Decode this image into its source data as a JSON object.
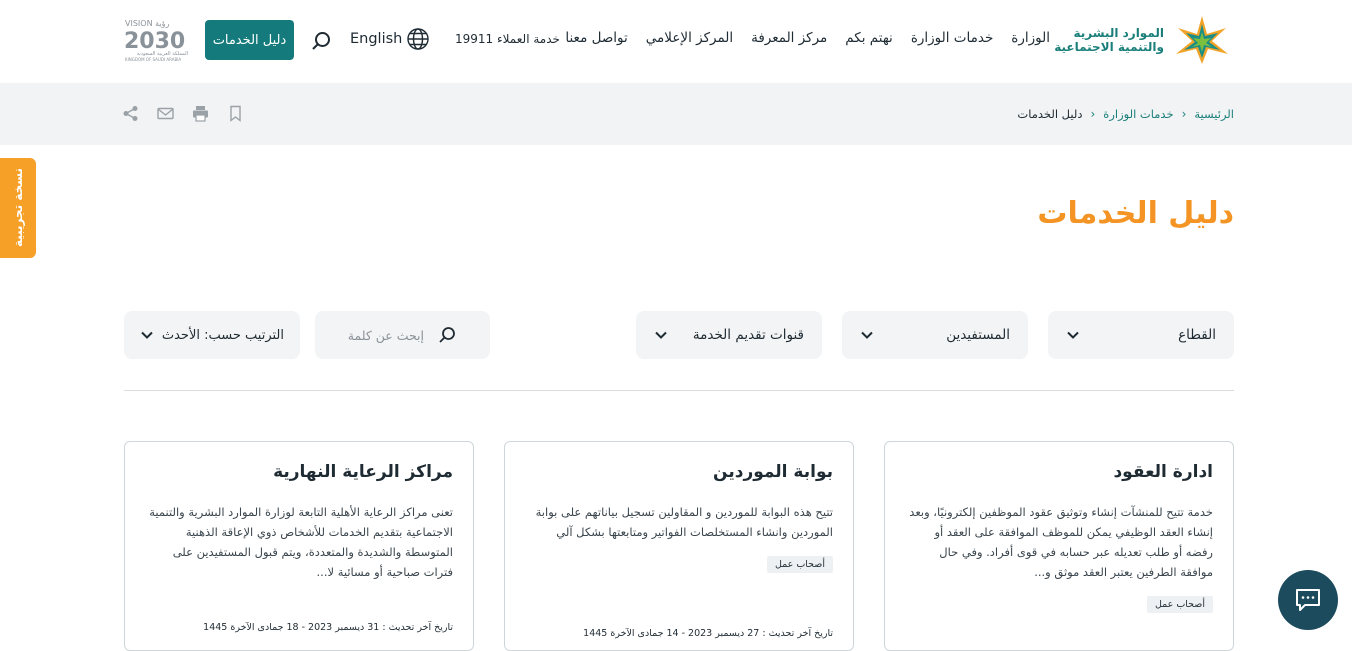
{
  "header": {
    "logo_line1": "الموارد البشرية",
    "logo_line2": "والتنمية الاجتماعية",
    "nav": [
      "الوزارة",
      "خدمات الوزارة",
      "نهتم بكم",
      "مركز المعرفة",
      "المركز الإعلامي",
      "تواصل معنا"
    ],
    "hotline": "خدمة العملاء 19911",
    "language": "English",
    "guide_button": "دليل الخدمات",
    "vision_top": "VISION رؤية",
    "vision_year": "2030",
    "vision_sub": "المملكة العربية السعودية",
    "vision_en": "KINGDOM OF SAUDI ARABIA"
  },
  "breadcrumb": {
    "home": "الرئيسية",
    "services": "خدمات الوزارة",
    "current": "دليل الخدمات"
  },
  "side_tab": "نسخة تجريبية",
  "page_title": "دليل الخدمات",
  "filters": {
    "sector": "القطاع",
    "beneficiaries": "المستفيدين",
    "channels": "قنوات تقديم الخدمة",
    "search_placeholder": "إبحث عن كلمة",
    "sort": "الترتيب حسب: الأحدث"
  },
  "cards": [
    {
      "title": "ادارة العقود",
      "desc": "خدمة تتيح للمنشآت إنشاء وتوثيق عقود الموظفين إلكترونيًا، وبعد إنشاء العقد الوظيفي يمكن للموظف الموافقة على العقد أو رفضه أو طلب تعديله عبر حسابه في قوى أفراد. وفي حال موافقة الطرفين يعتبر العقد موثق و...",
      "tag": "أصحاب عمل",
      "updated": ""
    },
    {
      "title": "بوابة الموردين",
      "desc": "تتيح هذه البوابة للموردين و المقاولين تسجيل بياناتهم على بوابة الموردين وانشاء المستخلصات الفواتير ومتابعتها بشكل آلي",
      "tag": "أصحاب عمل",
      "updated": "تاريخ آخر تحديث : 27 ديسمبر 2023 - 14 جمادى الآخرة 1445"
    },
    {
      "title": "مراكز الرعاية النهارية",
      "desc": "تعنى مراكز الرعاية الأهلية التابعة لوزارة الموارد البشرية والتنمية الاجتماعية بتقديم الخدمات للأشخاص ذوي الإعاقة الذهنية المتوسطة والشديدة والمتعددة، ويتم قبول المستفيدين على فترات صباحية أو مسائية لا...",
      "tag": "",
      "updated": "تاريخ آخر تحديث : 31 ديسمبر 2023 - 18 جمادى الآخرة 1445"
    }
  ],
  "colors": {
    "brand_teal": "#147a7c",
    "accent_orange": "#f39425",
    "chat_navy": "#1d4b5e"
  }
}
